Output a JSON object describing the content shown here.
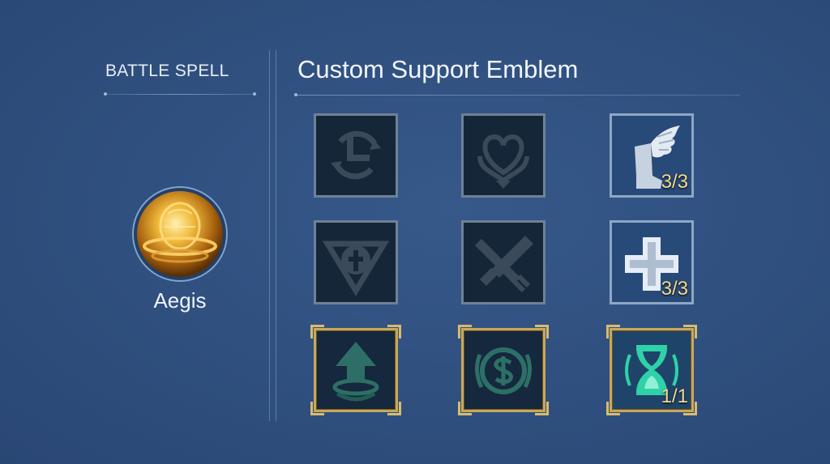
{
  "battle_spell": {
    "section_title": "BATTLE SPELL",
    "spell_name": "Aegis",
    "spell_icon": "aegis-shield-orb-icon"
  },
  "emblem": {
    "section_title": "Custom Support Emblem",
    "talents": [
      {
        "icon": "cooldown-cycle-icon",
        "state": "inactive",
        "count": ""
      },
      {
        "icon": "heart-emblem-icon",
        "state": "inactive",
        "count": ""
      },
      {
        "icon": "winged-boot-icon",
        "state": "active",
        "count": "3/3"
      },
      {
        "icon": "shield-cross-icon",
        "state": "inactive",
        "count": ""
      },
      {
        "icon": "crossed-swords-icon",
        "state": "inactive",
        "count": ""
      },
      {
        "icon": "plus-cross-icon",
        "state": "active",
        "count": "3/3"
      },
      {
        "icon": "arrow-up-swirl-icon",
        "state": "inactive-core",
        "count": ""
      },
      {
        "icon": "gold-coin-icon",
        "state": "inactive-core",
        "count": ""
      },
      {
        "icon": "hourglass-icon",
        "state": "active-core",
        "count": "1/1"
      }
    ]
  },
  "colors": {
    "background": "#2f4f7e",
    "count_text": "#f5d990",
    "core_frame": "#c9a85a",
    "active_tile": "#284a78"
  }
}
